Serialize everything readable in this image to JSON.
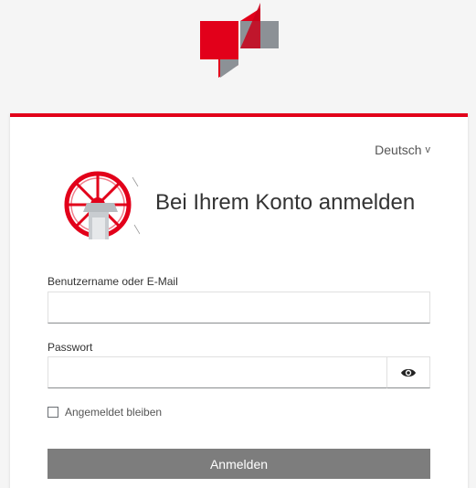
{
  "header": {
    "logo_icon": "brand-logo-icon",
    "colors": {
      "brand_red": "#e2001a",
      "brand_gray": "#8c9196"
    }
  },
  "card": {
    "language_selector": "Deutsch",
    "language_chevron": "v",
    "emblem_icon": "red-wheel-emblem-icon",
    "title": "Bei Ihrem Konto anmelden"
  },
  "form": {
    "username_label": "Benutzername oder E-Mail",
    "username_value": "",
    "password_label": "Passwort",
    "password_value": "",
    "show_password_icon": "eye-icon",
    "remember_label": "Angemeldet bleiben",
    "remember_checked": false,
    "submit_label": "Anmelden",
    "submit_color": "#7d7d7d"
  }
}
